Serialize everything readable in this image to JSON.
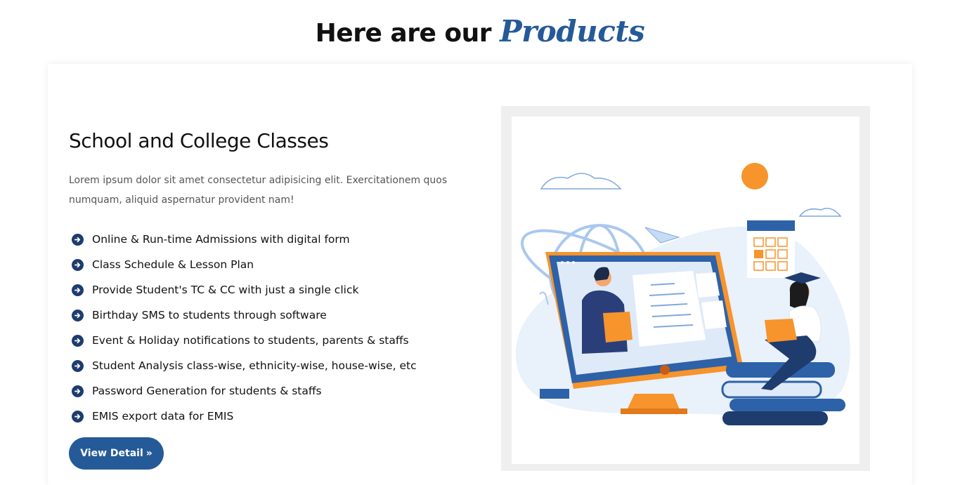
{
  "heading": {
    "prefix": "Here are our",
    "accent": "Products"
  },
  "product": {
    "title": "School and College Classes",
    "description": "Lorem ipsum dolor sit amet consectetur adipisicing elit. Exercitationem quos numquam, aliquid aspernatur provident nam!",
    "features": [
      "Online & Run-time Admissions with digital form",
      "Class Schedule & Lesson Plan",
      "Provide Student's TC & CC with just a single click",
      "Birthday SMS to students through software",
      "Event & Holiday notifications to students, parents & staffs",
      "Student Analysis class-wise, ethnicity-wise, house-wise, etc",
      "Password Generation for students & staffs",
      "EMIS export data for EMIS"
    ],
    "button_label": "View Detail",
    "button_icon": "double-chevron-right-icon",
    "illustration": "online-education-illustration"
  },
  "colors": {
    "brand": "#255a98",
    "accent_orange": "#f7942c",
    "navy": "#1e3c6e"
  }
}
